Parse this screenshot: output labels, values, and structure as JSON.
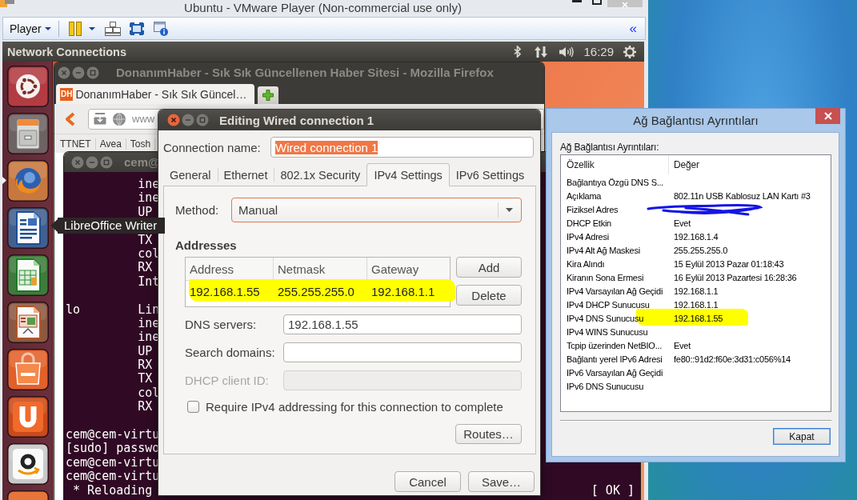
{
  "host_window": {
    "title": "Ubuntu - VMware Player (Non-commercial use only)",
    "toolbar": {
      "menu": "Player",
      "collapse": "«"
    }
  },
  "guest_panel": {
    "app_name": "Network Connections",
    "clock": "16:29"
  },
  "launcher": {
    "items": [
      {
        "kind": "dash",
        "running": false
      },
      {
        "kind": "files",
        "running": false
      },
      {
        "kind": "firefox",
        "running": true
      },
      {
        "kind": "writer",
        "running": false,
        "tooltip": "LibreOffice Writer"
      },
      {
        "kind": "calc",
        "running": false
      },
      {
        "kind": "impress",
        "running": false
      },
      {
        "kind": "software",
        "running": false
      },
      {
        "kind": "ubuntu_one",
        "running": false
      },
      {
        "kind": "amazon",
        "running": false
      },
      {
        "kind": "cut_off",
        "running": false
      }
    ]
  },
  "firefox_window": {
    "active": false,
    "title": "DonanımHaber - Sık Sık Güncellenen Haber Sitesi - Mozilla Firefox",
    "tabs": [
      {
        "favicon": "DH",
        "label": "DonanımHaber - Sık Sık Güncel…",
        "selected": true
      }
    ],
    "address": "www",
    "bookmarks": [
      "TTNET",
      "Avea",
      "Tosh"
    ]
  },
  "terminal_window": {
    "active": false,
    "title": "cem@",
    "lines": [
      {
        "kind": "indented",
        "text": "ine"
      },
      {
        "kind": "indented",
        "text": "ine"
      },
      {
        "kind": "indented",
        "text": "UP"
      },
      {
        "kind": "blank"
      },
      {
        "kind": "indented",
        "text": "TX"
      },
      {
        "kind": "indented",
        "text": "col"
      },
      {
        "kind": "indented",
        "text": "RX"
      },
      {
        "kind": "indented",
        "text": "Int"
      },
      {
        "kind": "blank"
      },
      {
        "kind": "plain",
        "text": "lo        Lin"
      },
      {
        "kind": "indented",
        "text": "ine"
      },
      {
        "kind": "indented",
        "text": "ine"
      },
      {
        "kind": "indented",
        "text": "UP"
      },
      {
        "kind": "indented",
        "text": "RX"
      },
      {
        "kind": "indented",
        "text": "TX"
      },
      {
        "kind": "indented",
        "text": "col"
      },
      {
        "kind": "indented",
        "text": "RX"
      },
      {
        "kind": "blank"
      },
      {
        "kind": "plain",
        "text": "cem@cem-virtu"
      },
      {
        "kind": "plain",
        "text": "[sudo] passwo"
      },
      {
        "kind": "plain",
        "text": "cem@cem-virtu"
      },
      {
        "kind": "plain",
        "text": "cem@cem-virtu"
      },
      {
        "kind": "status",
        "text": "* Reloading",
        "status": "[ OK ]"
      }
    ]
  },
  "connection_dialog": {
    "active": true,
    "title": "Editing Wired connection 1",
    "connection_name": {
      "label": "Connection name:",
      "value": "Wired connection 1",
      "text_selected": true
    },
    "tabs": [
      {
        "label": "General",
        "selected": false
      },
      {
        "label": "Ethernet",
        "selected": false
      },
      {
        "label": "802.1x Security",
        "selected": false
      },
      {
        "label": "IPv4 Settings",
        "selected": true
      },
      {
        "label": "IPv6 Settings",
        "selected": false
      }
    ],
    "method": {
      "label": "Method:",
      "value": "Manual",
      "focused": true
    },
    "addresses": {
      "heading": "Addresses",
      "columns": [
        "Address",
        "Netmask",
        "Gateway"
      ],
      "rows": [
        {
          "cells": [
            "192.168.1.55",
            "255.255.255.0",
            "192.168.1.1"
          ],
          "marker": true
        }
      ],
      "buttons": [
        "Add",
        "Delete"
      ]
    },
    "fields": [
      {
        "label": "DNS servers:",
        "value": "192.168.1.55",
        "disabled": false
      },
      {
        "label": "Search domains:",
        "disabled": false
      },
      {
        "label": "DHCP client ID:",
        "disabled": true
      }
    ],
    "require_ipv4": {
      "label": "Require IPv4 addressing for this connection to complete",
      "checked": false
    },
    "routes_button": "Routes…",
    "buttons": [
      "Cancel",
      "Save…"
    ]
  },
  "details_dialog": {
    "title": "Ağ Bağlantısı Ayrıntıları",
    "caption": "Ağ Bağlantısı Ayrıntıları:",
    "columns": [
      "Özellik",
      "Değer"
    ],
    "rows": [
      {
        "property": "Bağlantıya Özgü DNS S...",
        "marker": false,
        "redacted": false
      },
      {
        "property": "Açıklama",
        "value": "802.11n USB Kablosuz LAN Kartı #3",
        "marker": false,
        "redacted": false
      },
      {
        "property": "Fiziksel Adres",
        "marker": false,
        "redacted": true
      },
      {
        "property": "DHCP Etkin",
        "value": "Evet",
        "marker": false,
        "redacted": false
      },
      {
        "property": "IPv4 Adresi",
        "value": "192.168.1.4",
        "marker": false,
        "redacted": false
      },
      {
        "property": "IPv4 Alt Ağ Maskesi",
        "value": "255.255.255.0",
        "marker": false,
        "redacted": false
      },
      {
        "property": "Kira Alındı",
        "value": "15 Eylül 2013 Pazar 01:18:43",
        "marker": false,
        "redacted": false
      },
      {
        "property": "Kiranın Sona Ermesi",
        "value": "16 Eylül 2013 Pazartesi 16:28:36",
        "marker": false,
        "redacted": false
      },
      {
        "property": "IPv4 Varsayılan Ağ Geçidi",
        "value": "192.168.1.1",
        "marker": false,
        "redacted": false
      },
      {
        "property": "IPv4 DHCP Sunucusu",
        "value": "192.168.1.1",
        "marker": false,
        "redacted": false
      },
      {
        "property": "IPv4 DNS Sunucusu",
        "value": "192.168.1.55",
        "marker": true,
        "redacted": false
      },
      {
        "property": "IPv4 WINS Sunucusu",
        "marker": false,
        "redacted": false
      },
      {
        "property": "Tcpip üzerinden NetBIO...",
        "value": "Evet",
        "marker": false,
        "redacted": false
      },
      {
        "property": "Bağlantı yerel IPv6 Adresi",
        "value": "fe80::91d2:f60e:3d31:c056%14",
        "marker": false,
        "redacted": false
      },
      {
        "property": "IPv6 Varsayılan Ağ Geçidi",
        "marker": false,
        "redacted": false
      },
      {
        "property": "IPv6 DNS Sunucusu",
        "marker": false,
        "redacted": false
      }
    ],
    "close_button": {
      "label": "Kapat",
      "default": true
    }
  }
}
